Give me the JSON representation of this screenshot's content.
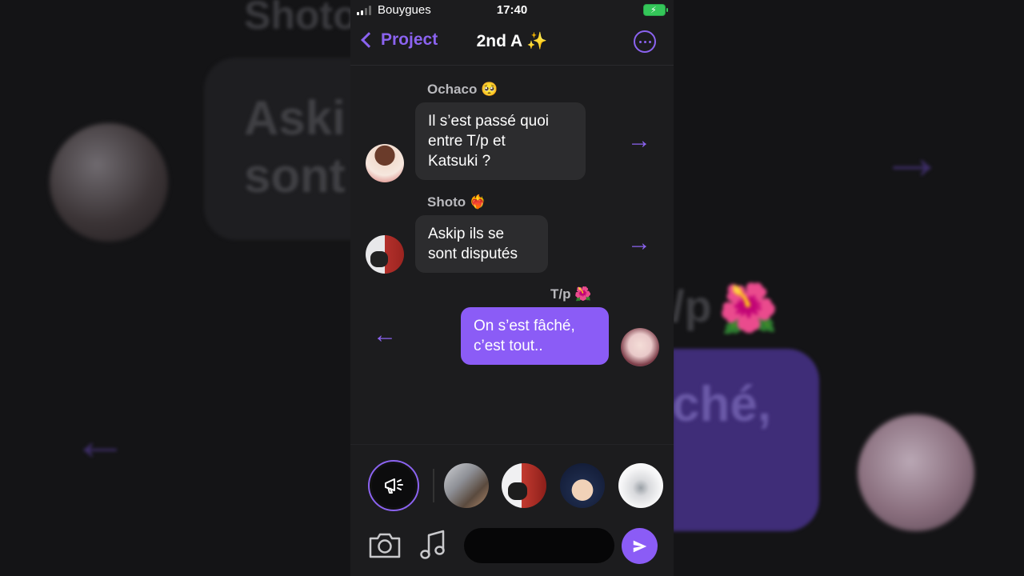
{
  "status_bar": {
    "carrier": "Bouygues",
    "time": "17:40"
  },
  "navbar": {
    "back_label": "Project",
    "title": "2nd A ✨"
  },
  "messages": [
    {
      "sender": "Ochaco 🥺",
      "text": "Il s’est passé quoi\nentre T/p et\nKatsuki ?",
      "direction": "incoming"
    },
    {
      "sender": "Shoto ❤️‍🔥",
      "text": "Askip ils se\nsont disputés",
      "direction": "incoming"
    },
    {
      "sender": "T/p 🌺",
      "text": "On s’est fâché,\nc’est tout..",
      "direction": "outgoing"
    }
  ],
  "arrows": {
    "right": "→",
    "left": "←"
  },
  "background": {
    "name": "Shoto",
    "bubble_text": "Aski\nsont",
    "tp": "/p",
    "flower": "🌺",
    "purple_text": "ché,"
  },
  "colors": {
    "accent": "#8b5cf6",
    "incoming_bubble": "#2c2c2e",
    "background": "#1c1c1e"
  },
  "icons": [
    "chevron-left-icon",
    "more-icon",
    "megaphone-icon",
    "camera-icon",
    "music-note-icon",
    "send-icon"
  ],
  "composer": {
    "value": "",
    "placeholder": ""
  }
}
